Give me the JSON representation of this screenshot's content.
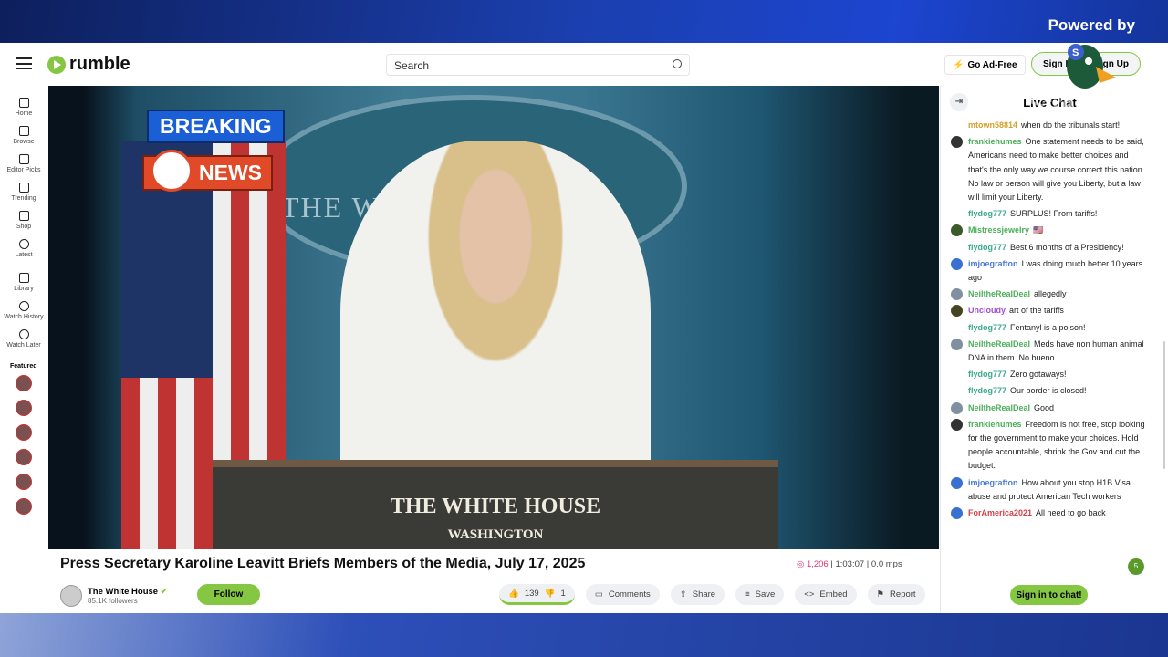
{
  "overlay": {
    "powered_by": "Powered by",
    "streamyard": "StreamYard",
    "breaking": "BREAKING",
    "news": "NEWS"
  },
  "header": {
    "logo": "rumble",
    "search_placeholder": "Search",
    "go_ad_free": "Go Ad-Free",
    "sign_in": "Sign In",
    "sign_up": "Sign Up"
  },
  "sidebar": {
    "items": [
      {
        "label": "Home",
        "icon": "home-icon"
      },
      {
        "label": "Browse",
        "icon": "browse-icon"
      },
      {
        "label": "Editor Picks",
        "icon": "award-icon"
      },
      {
        "label": "Trending",
        "icon": "trending-icon"
      },
      {
        "label": "Shop",
        "icon": "shop-icon"
      },
      {
        "label": "Latest",
        "icon": "clock-icon"
      },
      {
        "label": "Library",
        "icon": "library-icon"
      },
      {
        "label": "Watch History",
        "icon": "history-icon"
      },
      {
        "label": "Watch Later",
        "icon": "clock-icon"
      }
    ],
    "featured": "Featured"
  },
  "video": {
    "seal_text": "THE WHITE HOUSE",
    "podium_title": "THE WHITE HOUSE",
    "podium_sub": "WASHINGTON",
    "title": "Press Secretary Karoline Leavitt Briefs Members of the Media, July 17, 2025",
    "views": "1,206",
    "duration": "1:03:07",
    "mps": "0.0 mps"
  },
  "channel": {
    "name": "The White House",
    "followers": "85.1K followers",
    "follow": "Follow"
  },
  "actions": {
    "likes": "139",
    "dislikes": "1",
    "comments": "Comments",
    "share": "Share",
    "save": "Save",
    "embed": "Embed",
    "report": "Report"
  },
  "chat": {
    "title": "Live Chat",
    "new_count": "5",
    "sign_in": "Sign in to chat!",
    "messages": [
      {
        "user": "mtown58814",
        "color": "#d4a02a",
        "text": "when do the tribunals start!"
      },
      {
        "user": "frankiehumes",
        "color": "#4cae5a",
        "text": "One statement needs to be said, Americans need to make better choices and that's the only way we course correct this nation. No law or person will give you Liberty, but a law will limit your Liberty."
      },
      {
        "user": "flydog777",
        "color": "#3aa88a",
        "text": "SURPLUS! From tariffs!"
      },
      {
        "user": "Mistressjewelry",
        "color": "#4cae5a",
        "text": "🇺🇸"
      },
      {
        "user": "flydog777",
        "color": "#3aa88a",
        "text": "Best 6 months of a Presidency!"
      },
      {
        "user": "imjoegrafton",
        "color": "#4a7ad0",
        "text": "I was doing much better 10 years ago"
      },
      {
        "user": "NeiltheRealDeal",
        "color": "#4cae5a",
        "text": "allegedly"
      },
      {
        "user": "Uncloudy",
        "color": "#a050d0",
        "text": "art of the tariffs"
      },
      {
        "user": "flydog777",
        "color": "#3aa88a",
        "text": "Fentanyl is a poison!"
      },
      {
        "user": "NeiltheRealDeal",
        "color": "#4cae5a",
        "text": "Meds have non human animal DNA in them. No bueno"
      },
      {
        "user": "flydog777",
        "color": "#3aa88a",
        "text": "Zero gotaways!"
      },
      {
        "user": "flydog777",
        "color": "#3aa88a",
        "text": "Our border is closed!"
      },
      {
        "user": "NeiltheRealDeal",
        "color": "#4cae5a",
        "text": "Good"
      },
      {
        "user": "frankiehumes",
        "color": "#4cae5a",
        "text": "Freedom is not free, stop looking for the government to make your choices. Hold people accountable, shrink the Gov and cut the budget."
      },
      {
        "user": "imjoegrafton",
        "color": "#4a7ad0",
        "text": "How about you stop H1B Visa abuse and protect American Tech workers"
      },
      {
        "user": "ForAmerica2021",
        "color": "#d0404a",
        "text": "All need to go back"
      }
    ]
  }
}
